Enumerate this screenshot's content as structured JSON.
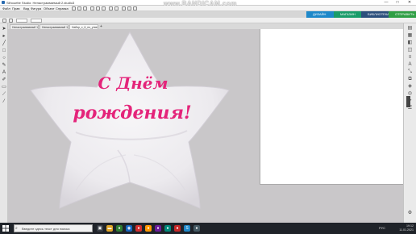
{
  "window": {
    "title": "Silhouette Studio: Ненастраиваемый 2.studio3",
    "controls": [
      "—",
      "□",
      "✕"
    ]
  },
  "watermark": "www.BANDICAM.com",
  "menu": [
    "Файл",
    "Прав",
    "Вид",
    "Фигура",
    "Объект",
    "Справка"
  ],
  "nav_tabs": [
    {
      "label": "ДИЗАЙН",
      "color": "#1e88c9"
    },
    {
      "label": "МАГАЗИН",
      "color": "#1a9c6a"
    },
    {
      "label": "БИБЛИОТЕКА",
      "color": "#2c4f7c"
    },
    {
      "label": "ОТПРАВИТЬ",
      "color": "#2f9e44"
    }
  ],
  "doc_tabs": [
    "Ненастраиваемый 10...",
    "Ненастраиваемый 10...",
    "Набор_с_6_по_утвер..."
  ],
  "canvas": {
    "balloon_text_line1": "С Днём",
    "balloon_text_line2": "рождения!",
    "balloon_text_color": "#e4247a"
  },
  "taskbar": {
    "search_placeholder": "Введите здесь текст для поиска",
    "time": "19:12",
    "date": "11.01.2021",
    "lang": "РУС"
  },
  "colors": {
    "canvas_bg": "#c9c7c9",
    "taskbar_bg": "#1f2329",
    "accent": "#1e88c9"
  }
}
